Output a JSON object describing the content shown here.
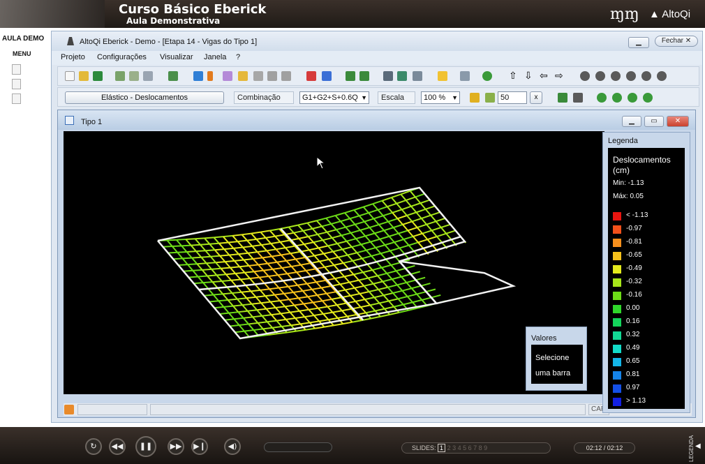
{
  "course": {
    "title": "Curso Básico Eberick",
    "subtitle": "Aula Demonstrativa",
    "brand": "AltoQi"
  },
  "left_panel": {
    "aula": "AULA DEMO",
    "menu": "MENU"
  },
  "app": {
    "title": "AltoQi Eberick - Demo - [Etapa 14 - Vigas do Tipo 1]",
    "close_label": "Fechar",
    "menu": [
      "Projeto",
      "Configurações",
      "Visualizar",
      "Janela",
      "?"
    ]
  },
  "toolbar2": {
    "mode_button": "Elástico - Deslocamentos",
    "combinacao_label": "Combinação",
    "combinacao_value": "G1+G2+S+0.6Q",
    "escala_label": "Escala",
    "escala_value": "100 %",
    "factor_value": "50",
    "x_button": "x"
  },
  "inner_window": {
    "title": "Tipo 1"
  },
  "valores": {
    "title": "Valores",
    "line1": "Selecione",
    "line2": "uma barra"
  },
  "legend": {
    "title": "Legenda",
    "heading": "Deslocamentos (cm)",
    "min": "Min: -1.13",
    "max": "Máx: 0.05",
    "entries": [
      {
        "label": "< -1.13",
        "color": "#e8150f"
      },
      {
        "label": "-0.97",
        "color": "#f2501a"
      },
      {
        "label": "-0.81",
        "color": "#f7901d"
      },
      {
        "label": "-0.65",
        "color": "#f7c21b"
      },
      {
        "label": "-0.49",
        "color": "#e3ea1c"
      },
      {
        "label": "-0.32",
        "color": "#a8e61a"
      },
      {
        "label": "-0.16",
        "color": "#6ddc17"
      },
      {
        "label": "0.00",
        "color": "#2fd82a"
      },
      {
        "label": "0.16",
        "color": "#14d55b"
      },
      {
        "label": "0.32",
        "color": "#12d994"
      },
      {
        "label": "0.49",
        "color": "#12dcc8"
      },
      {
        "label": "0.65",
        "color": "#14b6e8"
      },
      {
        "label": "0.81",
        "color": "#1583e8"
      },
      {
        "label": "0.97",
        "color": "#1450e6"
      },
      {
        "label": "> 1.13",
        "color": "#1220e2"
      }
    ]
  },
  "status": {
    "caps": "CAP"
  },
  "player": {
    "slides_label": "SLIDES:",
    "current_slide": "1",
    "other_slides": "2  3  4  5  6  7  8  9",
    "time": "02:12 / 02:12",
    "legenda": "LEGENDA"
  }
}
